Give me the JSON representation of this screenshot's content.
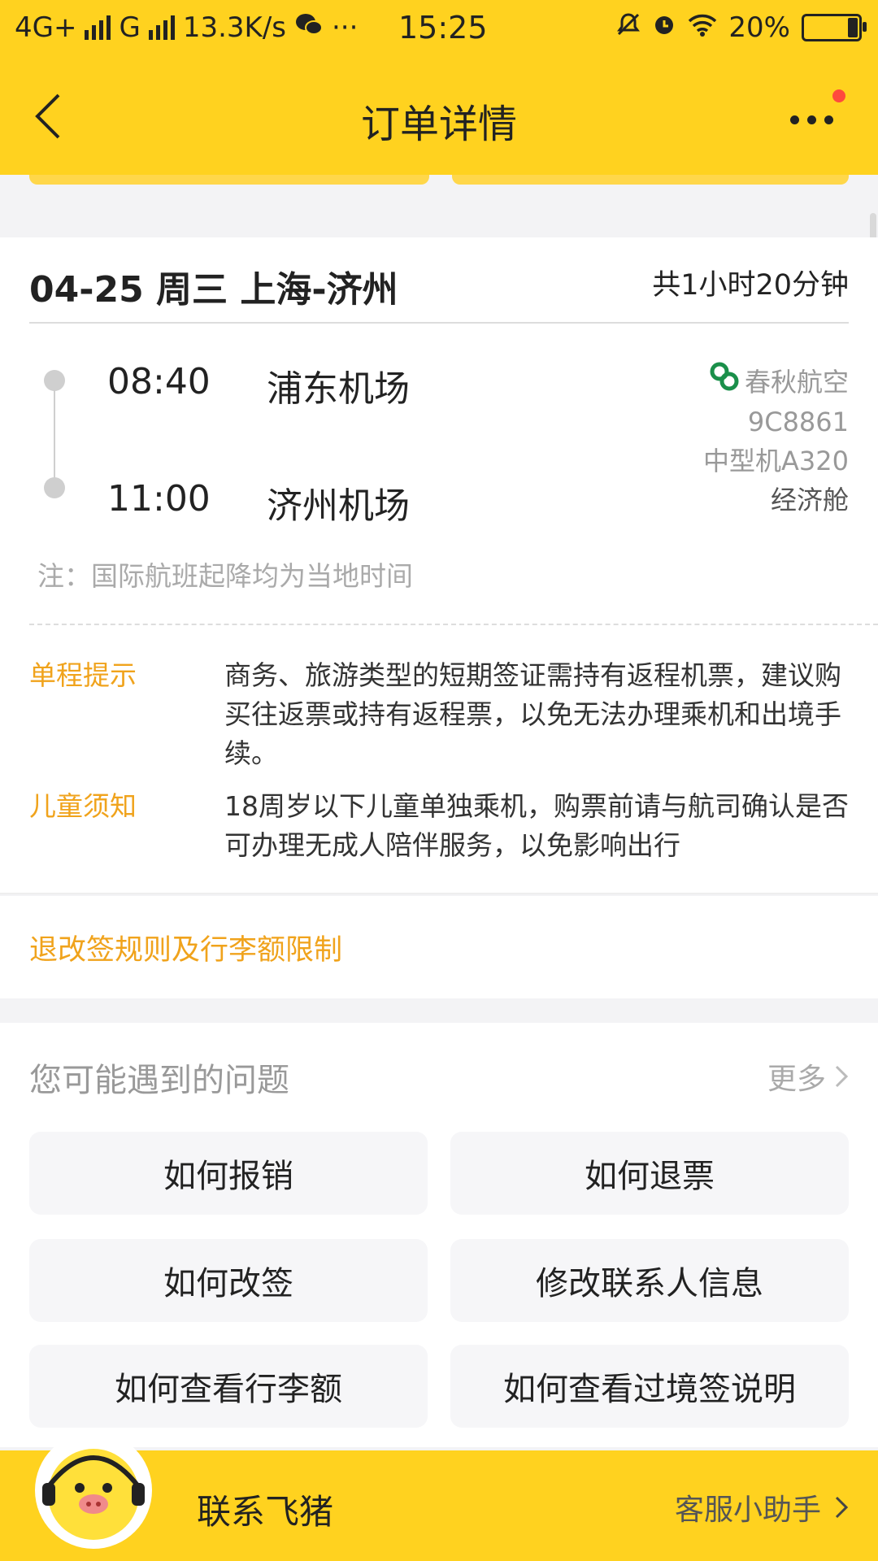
{
  "status_bar": {
    "network_left": "4G+",
    "network_mid": "G",
    "speed": "13.3K/s",
    "time": "15:25",
    "battery": "20%",
    "battery_level": 0.2
  },
  "header": {
    "title": "订单详情"
  },
  "flight": {
    "route_title": "04-25 周三 上海-济州",
    "duration": "共1小时20分钟",
    "departure": {
      "time": "08:40",
      "airport": "浦东机场"
    },
    "arrival": {
      "time": "11:00",
      "airport": "济州机场"
    },
    "airline": "春秋航空",
    "flight_no": "9C8861",
    "aircraft": "中型机A320",
    "cabin": "经济舱",
    "note": "注：国际航班起降均为当地时间"
  },
  "tips": [
    {
      "label": "单程提示",
      "text": "商务、旅游类型的短期签证需持有返程机票，建议购买往返票或持有返程票，以免无法办理乘机和出境手续。"
    },
    {
      "label": "儿童须知",
      "text": "18周岁以下儿童单独乘机，购票前请与航司确认是否可办理无成人陪伴服务，以免影响出行"
    }
  ],
  "rules_link": "退改签规则及行李额限制",
  "faq": {
    "title": "您可能遇到的问题",
    "more": "更多",
    "buttons": [
      "如何报销",
      "如何退票",
      "如何改签",
      "修改联系人信息",
      "如何查看行李额",
      "如何查看过境签说明"
    ]
  },
  "bottom": {
    "contact": "联系飞猪",
    "assistant": "客服小助手"
  },
  "colors": {
    "brand_yellow": "#ffd21f",
    "accent_orange": "#f0a31c",
    "airline_green": "#1a8f4a"
  }
}
